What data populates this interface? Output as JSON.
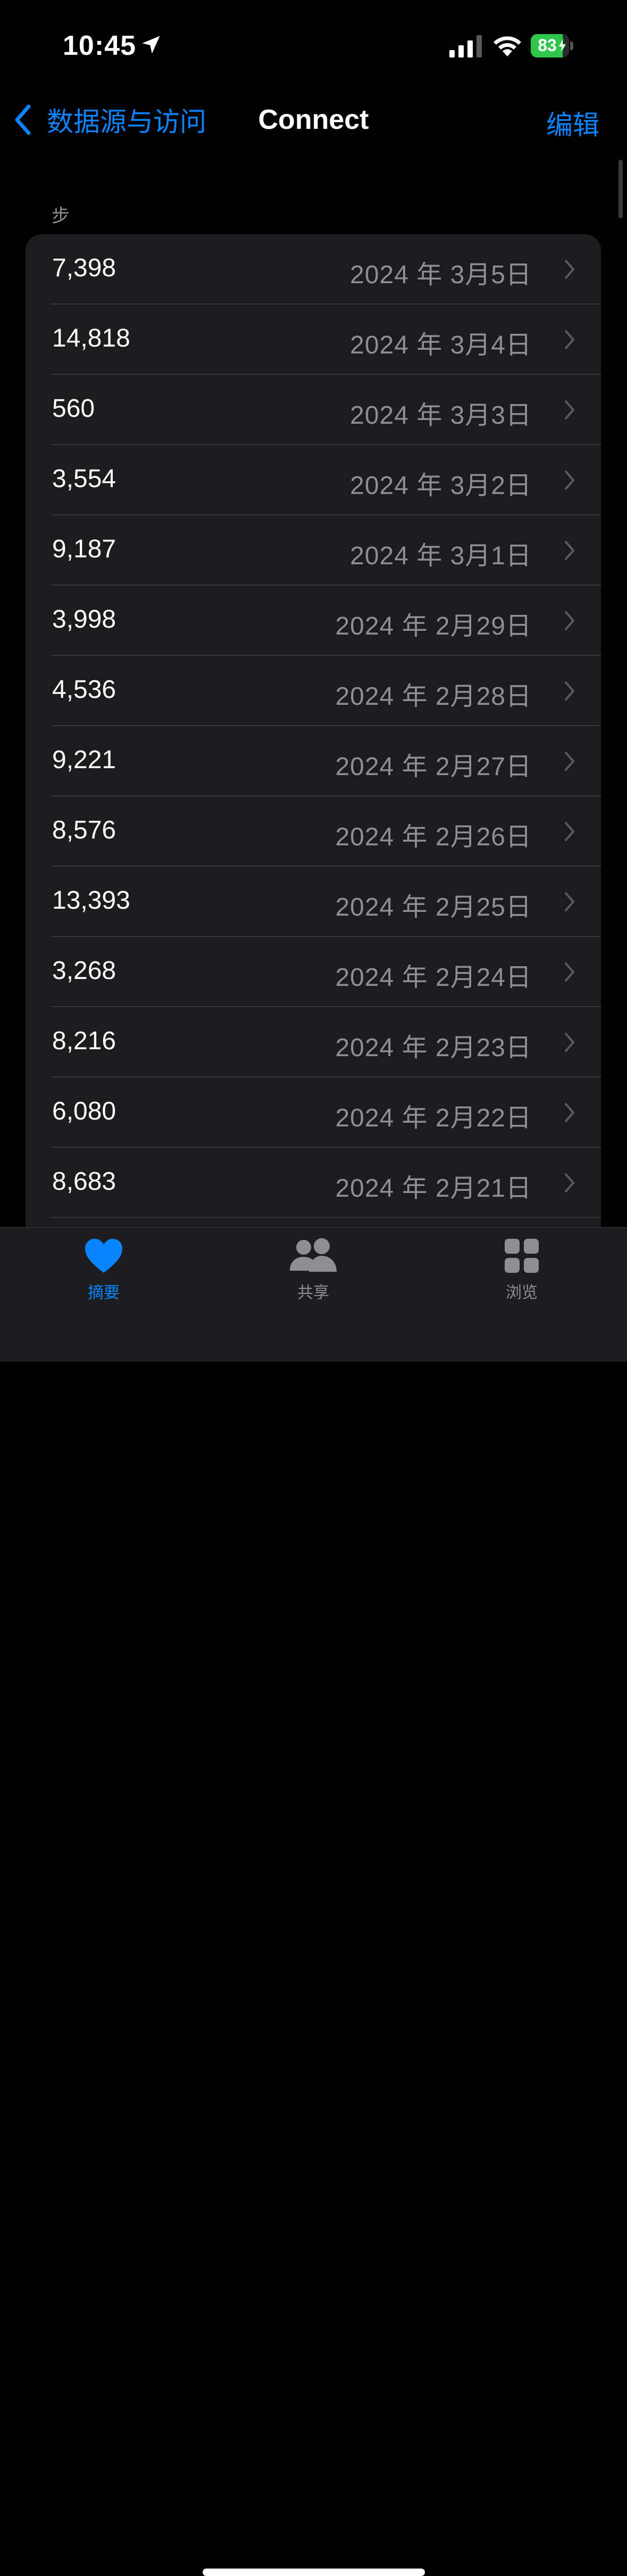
{
  "status_bar": {
    "time": "10:45",
    "battery_percent": "83",
    "battery_level": 0.83,
    "battery_color": "#2fc84d",
    "icons": [
      "location-arrow-icon",
      "cellular-signal-icon",
      "wifi-icon",
      "battery-icon",
      "charging-bolt-icon"
    ]
  },
  "nav": {
    "back_label": "数据源与访问",
    "title": "Connect",
    "edit_label": "编辑",
    "accent_color": "#0a84ff"
  },
  "section": {
    "header": "步"
  },
  "rows": [
    {
      "value": "7,398",
      "date": "2024 年 3月5日"
    },
    {
      "value": "14,818",
      "date": "2024 年 3月4日"
    },
    {
      "value": "560",
      "date": "2024 年 3月3日"
    },
    {
      "value": "3,554",
      "date": "2024 年 3月2日"
    },
    {
      "value": "9,187",
      "date": "2024 年 3月1日"
    },
    {
      "value": "3,998",
      "date": "2024 年 2月29日"
    },
    {
      "value": "4,536",
      "date": "2024 年 2月28日"
    },
    {
      "value": "9,221",
      "date": "2024 年 2月27日"
    },
    {
      "value": "8,576",
      "date": "2024 年 2月26日"
    },
    {
      "value": "13,393",
      "date": "2024 年 2月25日"
    },
    {
      "value": "3,268",
      "date": "2024 年 2月24日"
    },
    {
      "value": "8,216",
      "date": "2024 年 2月23日"
    },
    {
      "value": "6,080",
      "date": "2024 年 2月22日"
    },
    {
      "value": "8,683",
      "date": "2024 年 2月21日"
    }
  ],
  "tabs": [
    {
      "label": "摘要",
      "icon": "heart-icon",
      "active": true
    },
    {
      "label": "共享",
      "icon": "people-icon",
      "active": false
    },
    {
      "label": "浏览",
      "icon": "grid-icon",
      "active": false
    }
  ]
}
